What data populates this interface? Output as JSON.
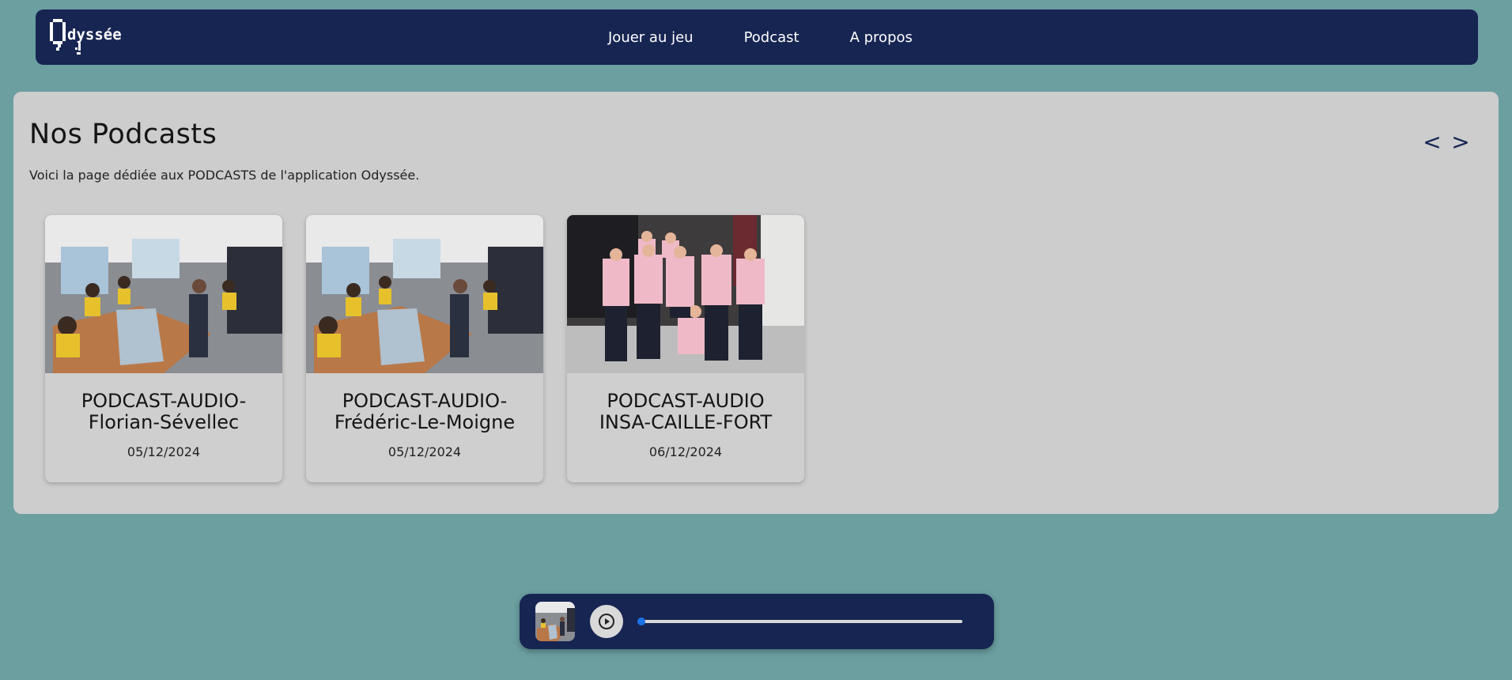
{
  "app": {
    "logo_text": "Odyssée"
  },
  "nav": {
    "items": [
      {
        "label": "Jouer au jeu"
      },
      {
        "label": "Podcast"
      },
      {
        "label": "A propos"
      }
    ]
  },
  "main": {
    "title": "Nos Podcasts",
    "subtitle": "Voici la page dédiée aux PODCASTS de l'application Odyssée.",
    "prev_arrow": "<",
    "next_arrow": ">",
    "cards": [
      {
        "title_line1": "PODCAST-AUDIO-",
        "title_line2": "Florian-Sévellec",
        "date": "05/12/2024",
        "image": "classroom-boat-photo"
      },
      {
        "title_line1": "PODCAST-AUDIO-",
        "title_line2": "Frédéric-Le-Moigne",
        "date": "05/12/2024",
        "image": "classroom-boat-photo"
      },
      {
        "title_line1": "PODCAST-AUDIO",
        "title_line2": "INSA-CAILLE-FORT",
        "date": "06/12/2024",
        "image": "group-pink-hoodies-photo"
      }
    ]
  },
  "player": {
    "progress": 0.01,
    "play_icon": "play-icon",
    "colors": {
      "accent": "#1a73e8",
      "bar": "#172552"
    }
  },
  "colors": {
    "background": "#6b9fa0",
    "navbar": "#172552",
    "panel": "#cdcdcd"
  }
}
